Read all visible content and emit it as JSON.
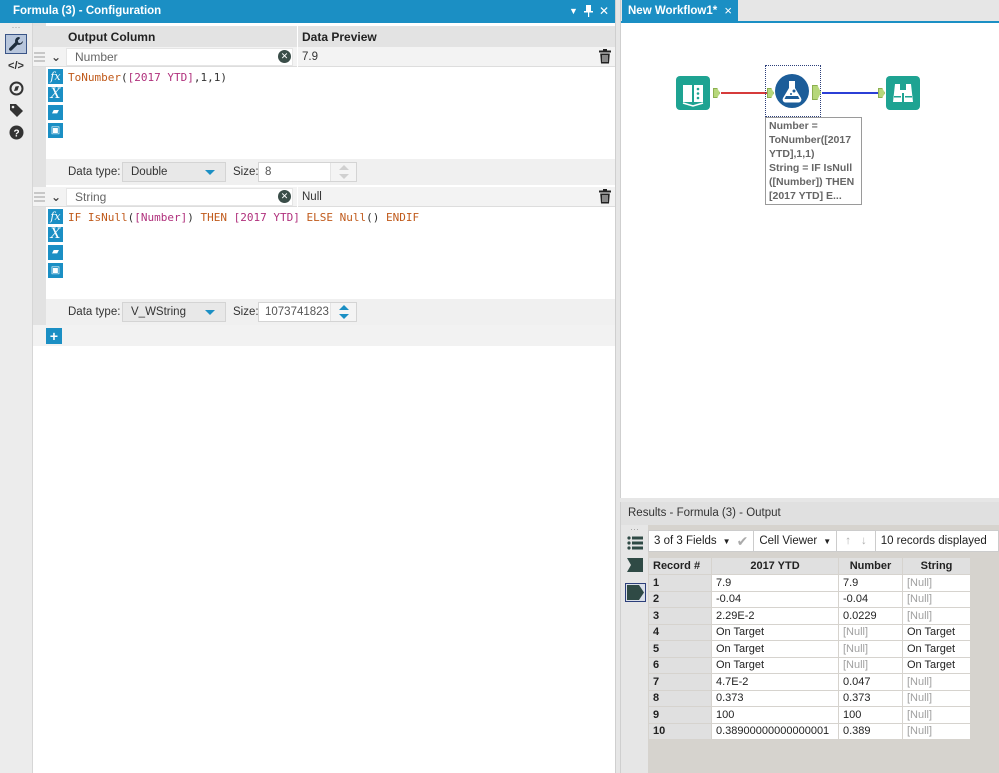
{
  "config_panel": {
    "title": "Formula (3) - Configuration",
    "controls": [
      "▾",
      "pin",
      "×"
    ],
    "headers": {
      "output_column": "Output Column",
      "data_preview": "Data Preview"
    },
    "rail_icons": [
      "wrench-icon",
      "code-icon",
      "compass-icon",
      "tag-icon",
      "help-icon"
    ],
    "fields": [
      {
        "name": "Number",
        "preview": "7.9",
        "expression": {
          "parts": [
            {
              "t": "ToNumber",
              "c": "kw"
            },
            {
              "t": "(",
              "c": "pl"
            },
            {
              "t": "[2017 YTD]",
              "c": "fld"
            },
            {
              "t": ",1,1)",
              "c": "pl"
            }
          ]
        },
        "data_type_label": "Data type:",
        "data_type": "Double",
        "size_label": "Size:",
        "size": "8"
      },
      {
        "name": "String",
        "preview": "Null",
        "expression": {
          "parts": [
            {
              "t": "IF ",
              "c": "kw"
            },
            {
              "t": "IsNull",
              "c": "kw"
            },
            {
              "t": "(",
              "c": "pl"
            },
            {
              "t": "[Number]",
              "c": "fld"
            },
            {
              "t": ") ",
              "c": "pl"
            },
            {
              "t": "THEN ",
              "c": "kw"
            },
            {
              "t": "[2017 YTD]",
              "c": "fld"
            },
            {
              "t": " ",
              "c": "pl"
            },
            {
              "t": "ELSE ",
              "c": "kw"
            },
            {
              "t": "Null",
              "c": "kw"
            },
            {
              "t": "() ",
              "c": "pl"
            },
            {
              "t": "ENDIF",
              "c": "kw"
            }
          ]
        },
        "data_type_label": "Data type:",
        "data_type": "V_WString",
        "size_label": "Size:",
        "size": "1073741823"
      }
    ],
    "add_label": "+"
  },
  "workflow": {
    "tab_label": "New Workflow1*",
    "tab_close": "×",
    "annotation_lines": [
      "Number =",
      "ToNumber([2017",
      "YTD],1,1)",
      "String = IF IsNull",
      "([Number]) THEN",
      "[2017 YTD] E..."
    ]
  },
  "results": {
    "title": "Results - Formula (3) - Output",
    "fields_selector": "3 of 3 Fields",
    "viewer": "Cell Viewer",
    "records_displayed": "10 records displayed",
    "columns": [
      "Record #",
      "2017 YTD",
      "Number",
      "String"
    ],
    "rows": [
      [
        "1",
        "7.9",
        "7.9",
        "[Null]"
      ],
      [
        "2",
        "-0.04",
        "-0.04",
        "[Null]"
      ],
      [
        "3",
        "2.29E-2",
        "0.0229",
        "[Null]"
      ],
      [
        "4",
        "On Target",
        "[Null]",
        "On Target"
      ],
      [
        "5",
        "On Target",
        "[Null]",
        "On Target"
      ],
      [
        "6",
        "On Target",
        "[Null]",
        "On Target"
      ],
      [
        "7",
        "4.7E-2",
        "0.047",
        "[Null]"
      ],
      [
        "8",
        "0.373",
        "0.373",
        "[Null]"
      ],
      [
        "9",
        "100",
        "100",
        "[Null]"
      ],
      [
        "10",
        "0.38900000000000001",
        "0.389",
        "[Null]"
      ]
    ]
  },
  "colors": {
    "accent": "#1b8fc4",
    "tool_teal": "#1ea392",
    "formula_blue": "#1c5d99",
    "keyword": "#c05a1b",
    "field": "#b0307c",
    "null_gray": "#a0a0a0"
  }
}
